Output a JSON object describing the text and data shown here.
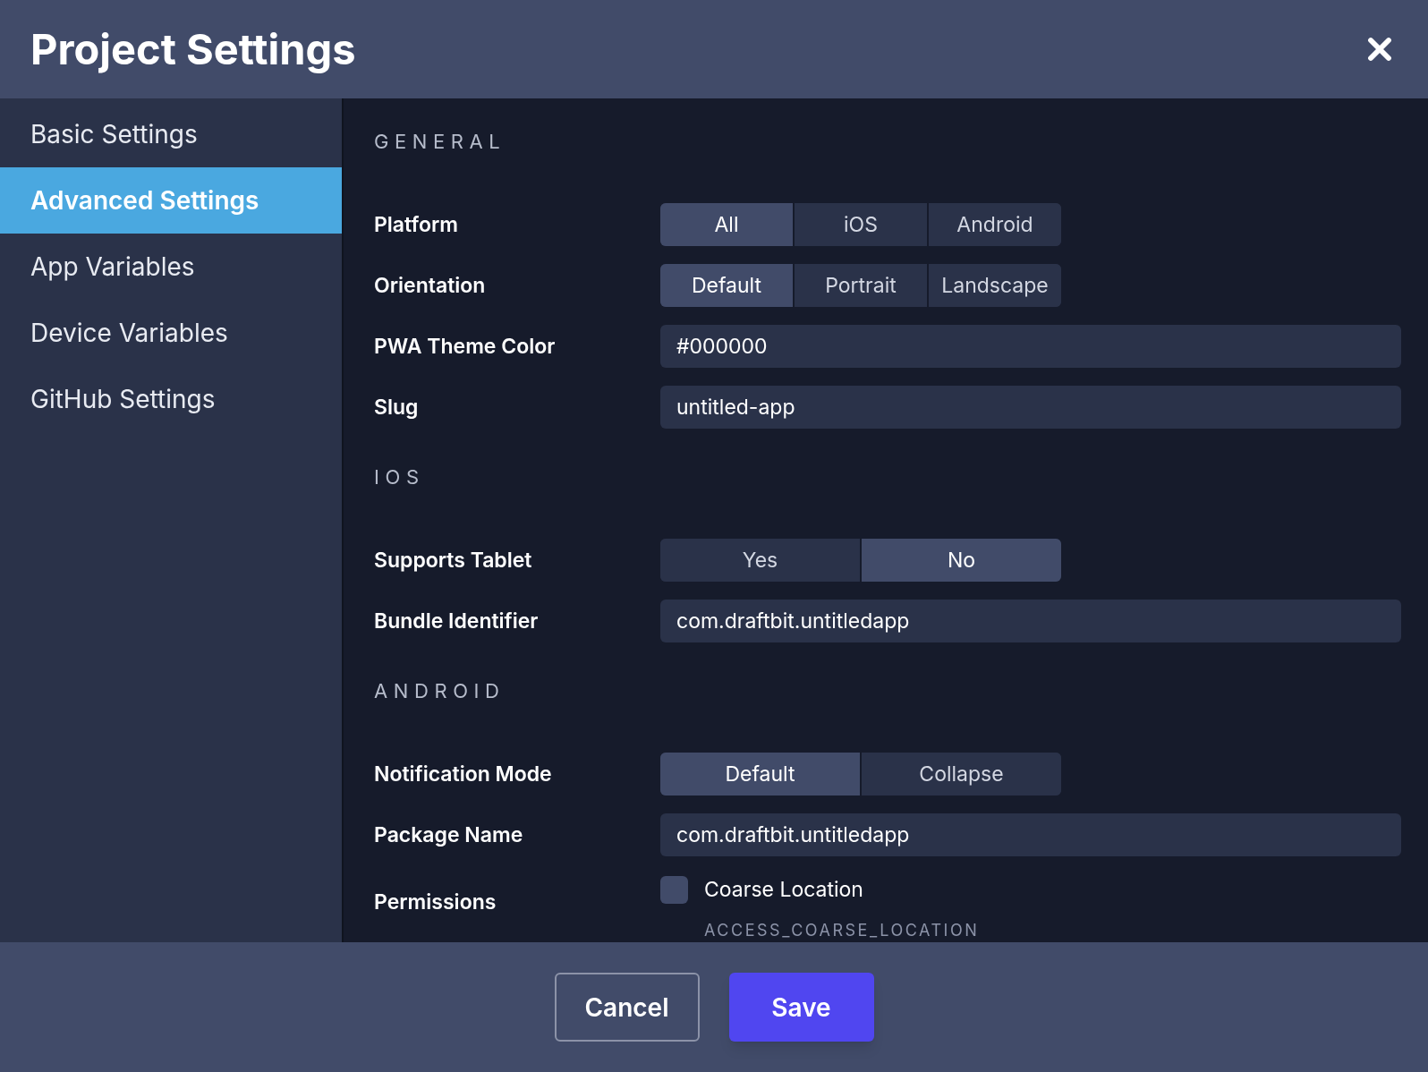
{
  "dialog": {
    "title": "Project Settings"
  },
  "sidebar": {
    "items": [
      {
        "label": "Basic Settings",
        "selected": false
      },
      {
        "label": "Advanced Settings",
        "selected": true
      },
      {
        "label": "App Variables",
        "selected": false
      },
      {
        "label": "Device Variables",
        "selected": false
      },
      {
        "label": "GitHub Settings",
        "selected": false
      }
    ]
  },
  "sections": [
    {
      "heading": "GENERAL",
      "rows": [
        {
          "kind": "segmented",
          "label": "Platform",
          "options": [
            {
              "label": "All",
              "selected": true
            },
            {
              "label": "iOS",
              "selected": false
            },
            {
              "label": "Android",
              "selected": false
            }
          ]
        },
        {
          "kind": "segmented",
          "label": "Orientation",
          "options": [
            {
              "label": "Default",
              "selected": true
            },
            {
              "label": "Portrait",
              "selected": false
            },
            {
              "label": "Landscape",
              "selected": false
            }
          ]
        },
        {
          "kind": "text",
          "label": "PWA Theme Color",
          "value": "#000000"
        },
        {
          "kind": "text",
          "label": "Slug",
          "value": "untitled-app"
        }
      ]
    },
    {
      "heading": "IOS",
      "rows": [
        {
          "kind": "segmented",
          "label": "Supports Tablet",
          "options": [
            {
              "label": "Yes",
              "selected": false
            },
            {
              "label": "No",
              "selected": true
            }
          ]
        },
        {
          "kind": "text",
          "label": "Bundle Identifier",
          "value": "com.draftbit.untitledapp"
        }
      ]
    },
    {
      "heading": "ANDROID",
      "rows": [
        {
          "kind": "segmented",
          "label": "Notification Mode",
          "options": [
            {
              "label": "Default",
              "selected": true
            },
            {
              "label": "Collapse",
              "selected": false
            }
          ]
        },
        {
          "kind": "text",
          "label": "Package Name",
          "value": "com.draftbit.untitledapp"
        },
        {
          "kind": "checkboxes",
          "label": "Permissions",
          "options": [
            {
              "label": "Coarse Location",
              "code": "ACCESS_COARSE_LOCATION",
              "checked": false
            }
          ]
        }
      ]
    }
  ],
  "footer": {
    "buttons": [
      {
        "kind": "secondary",
        "label": "Cancel"
      },
      {
        "kind": "primary",
        "label": "Save"
      }
    ]
  }
}
